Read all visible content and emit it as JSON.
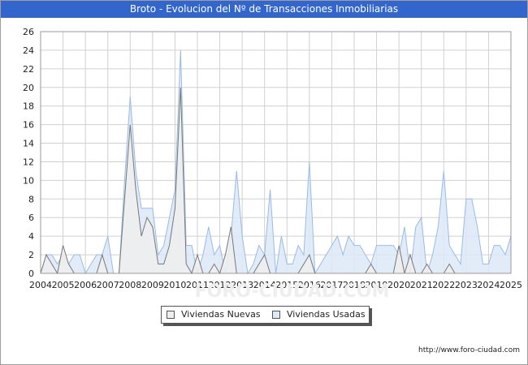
{
  "title": "Broto - Evolucion del Nº de Transacciones Inmobiliarias",
  "footer": "http://www.foro-ciudad.com",
  "watermark": "FORO-CIUDAD.COM",
  "colors": {
    "title_bg": "#3366cc",
    "nuevas_fill": "#eeeeee",
    "nuevas_line": "#777777",
    "usadas_fill": "#dde9f8",
    "usadas_line": "#99bbe6",
    "grid": "#d0d0d0"
  },
  "chart_data": {
    "type": "area",
    "ylim": [
      0,
      26
    ],
    "yticks": [
      0,
      2,
      4,
      6,
      8,
      10,
      12,
      14,
      16,
      18,
      20,
      22,
      24,
      26
    ],
    "xlim": [
      2004,
      2025
    ],
    "xticks": [
      2004,
      2005,
      2006,
      2007,
      2008,
      2009,
      2010,
      2011,
      2012,
      2013,
      2014,
      2015,
      2016,
      2017,
      2018,
      2019,
      2020,
      2021,
      2022,
      2023,
      2024,
      2025
    ],
    "grid": true,
    "legend_position": "bottom-center",
    "series": [
      {
        "name": "Viviendas Nuevas",
        "x": [
          2004,
          2004.25,
          2004.5,
          2004.75,
          2005,
          2005.25,
          2005.5,
          2005.75,
          2006,
          2006.25,
          2006.5,
          2006.75,
          2007,
          2007.25,
          2007.5,
          2007.75,
          2008,
          2008.25,
          2008.5,
          2008.75,
          2009,
          2009.25,
          2009.5,
          2009.75,
          2010,
          2010.25,
          2010.5,
          2010.75,
          2011,
          2011.25,
          2011.5,
          2011.75,
          2012,
          2012.25,
          2012.5,
          2012.75,
          2013,
          2013.25,
          2013.5,
          2013.75,
          2014,
          2014.25,
          2014.5,
          2014.75,
          2015,
          2015.25,
          2015.5,
          2015.75,
          2016,
          2016.25,
          2016.5,
          2016.75,
          2017,
          2017.25,
          2017.5,
          2017.75,
          2018,
          2018.25,
          2018.5,
          2018.75,
          2019,
          2019.25,
          2019.5,
          2019.75,
          2020,
          2020.25,
          2020.5,
          2020.75,
          2021,
          2021.25,
          2021.5,
          2021.75,
          2022,
          2022.25,
          2022.5,
          2022.75,
          2023,
          2023.25,
          2023.5,
          2023.75,
          2024,
          2024.25,
          2024.5,
          2024.75,
          2025
        ],
        "values": [
          0,
          2,
          1,
          0,
          3,
          1,
          0,
          0,
          0,
          0,
          0,
          2,
          0,
          0,
          0,
          8,
          16,
          9,
          4,
          6,
          5,
          1,
          1,
          3,
          7,
          20,
          1,
          0,
          2,
          0,
          0,
          1,
          0,
          2,
          5,
          0,
          0,
          0,
          0,
          1,
          2,
          0,
          0,
          0,
          0,
          0,
          0,
          1,
          2,
          0,
          0,
          0,
          0,
          0,
          0,
          0,
          0,
          0,
          0,
          1,
          0,
          0,
          0,
          0,
          3,
          0,
          2,
          0,
          0,
          1,
          0,
          0,
          0,
          1,
          0,
          0,
          0,
          0,
          0,
          0,
          0,
          0,
          0,
          0,
          0
        ]
      },
      {
        "name": "Viviendas Usadas",
        "x": [
          2004,
          2004.25,
          2004.5,
          2004.75,
          2005,
          2005.25,
          2005.5,
          2005.75,
          2006,
          2006.25,
          2006.5,
          2006.75,
          2007,
          2007.25,
          2007.5,
          2007.75,
          2008,
          2008.25,
          2008.5,
          2008.75,
          2009,
          2009.25,
          2009.5,
          2009.75,
          2010,
          2010.25,
          2010.5,
          2010.75,
          2011,
          2011.25,
          2011.5,
          2011.75,
          2012,
          2012.25,
          2012.5,
          2012.75,
          2013,
          2013.25,
          2013.5,
          2013.75,
          2014,
          2014.25,
          2014.5,
          2014.75,
          2015,
          2015.25,
          2015.5,
          2015.75,
          2016,
          2016.25,
          2016.5,
          2016.75,
          2017,
          2017.25,
          2017.5,
          2017.75,
          2018,
          2018.25,
          2018.5,
          2018.75,
          2019,
          2019.25,
          2019.5,
          2019.75,
          2020,
          2020.25,
          2020.5,
          2020.75,
          2021,
          2021.25,
          2021.5,
          2021.75,
          2022,
          2022.25,
          2022.5,
          2022.75,
          2023,
          2023.25,
          2023.5,
          2023.75,
          2024,
          2024.25,
          2024.5,
          2024.75,
          2025
        ],
        "values": [
          0,
          2,
          2,
          1,
          2,
          1,
          2,
          2,
          0,
          1,
          2,
          2,
          4,
          0,
          0,
          10,
          19,
          11,
          7,
          7,
          7,
          2,
          3,
          6,
          9,
          24,
          3,
          3,
          0,
          2,
          5,
          2,
          3,
          0,
          4,
          11,
          4,
          0,
          1,
          3,
          2,
          9,
          0,
          4,
          1,
          1,
          3,
          2,
          12,
          0,
          1,
          2,
          3,
          4,
          2,
          4,
          3,
          3,
          2,
          1,
          3,
          3,
          3,
          3,
          2,
          5,
          0,
          5,
          6,
          0,
          2,
          5,
          11,
          3,
          2,
          1,
          8,
          8,
          5,
          1,
          1,
          3,
          3,
          2,
          4
        ]
      }
    ]
  }
}
